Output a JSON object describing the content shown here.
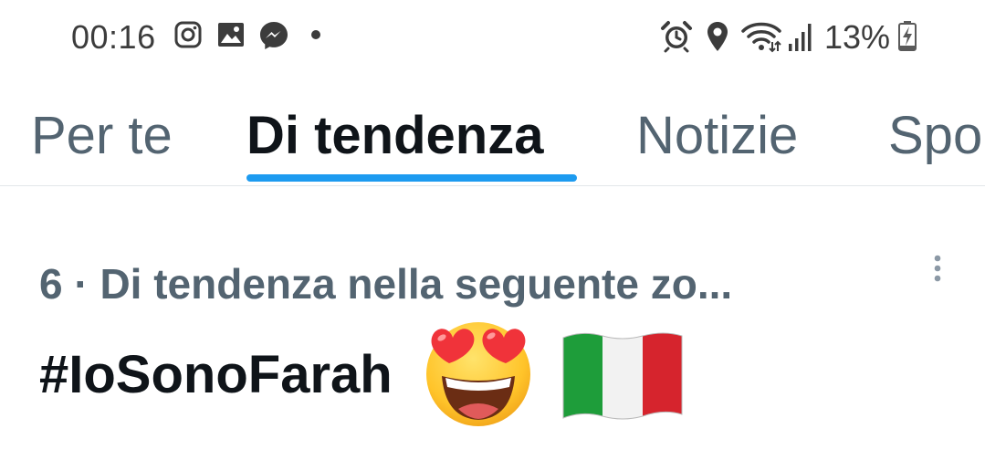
{
  "status_bar": {
    "time": "00:16",
    "left_icons": [
      "instagram-icon",
      "gallery-icon",
      "messenger-icon",
      "dot-icon"
    ],
    "right_icons": [
      "alarm-icon",
      "location-icon",
      "wifi-icon",
      "signal-icon",
      "battery-icon"
    ],
    "battery_percent": "13%"
  },
  "tabs": [
    {
      "label": "Per te",
      "active": false
    },
    {
      "label": "Di tendenza",
      "active": true
    },
    {
      "label": "Notizie",
      "active": false
    },
    {
      "label": "Sport",
      "active": false
    }
  ],
  "trend": {
    "meta": "6 · Di tendenza nella seguente zo...",
    "hashtag": "#IoSonoFarah",
    "emojis": [
      "heart-eyes-emoji",
      "italy-flag-emoji"
    ]
  },
  "colors": {
    "accent": "#1d9bf0",
    "secondary_text": "#536471",
    "primary_text": "#0f1419"
  }
}
